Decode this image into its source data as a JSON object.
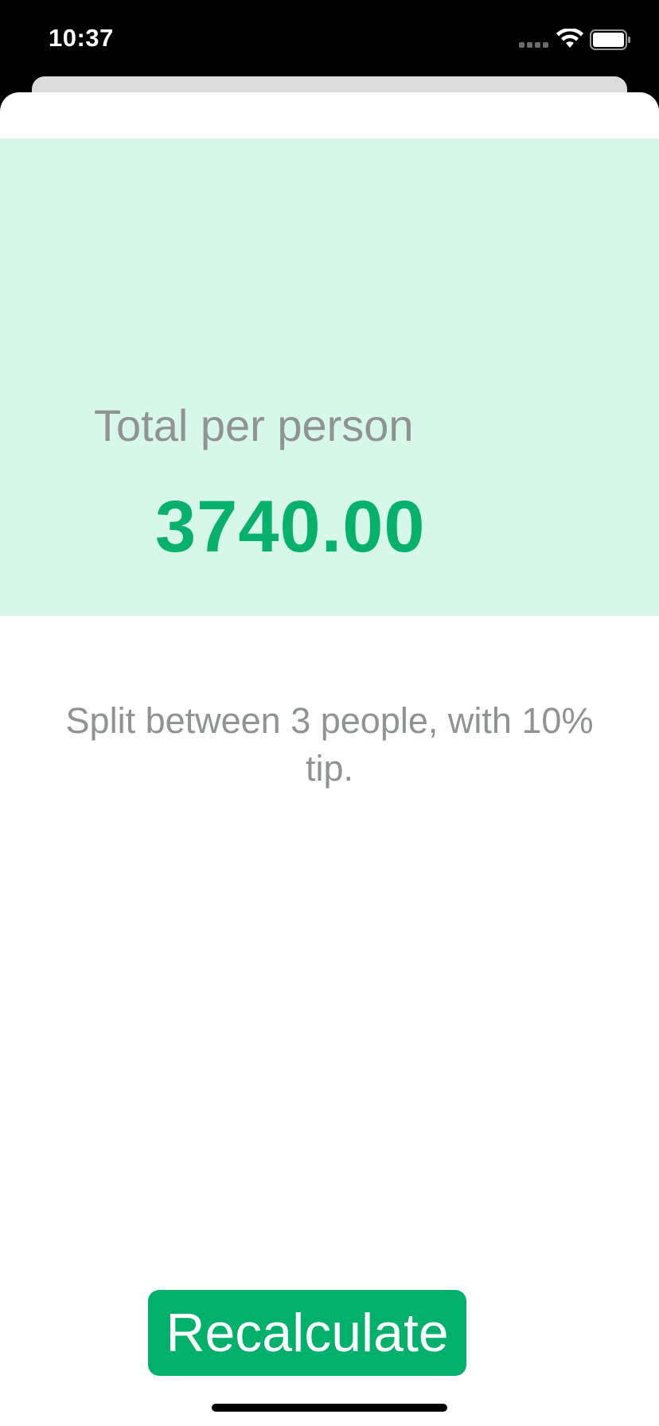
{
  "status_bar": {
    "time": "10:37",
    "signal_icon": "cellular-signal-icon",
    "wifi_icon": "wifi-icon",
    "battery_icon": "battery-full-icon"
  },
  "result": {
    "label": "Total per person",
    "value": "3740.00"
  },
  "settings": {
    "text": "Split between 3 people, with 10% tip."
  },
  "actions": {
    "recalculate_label": "Recalculate"
  },
  "colors": {
    "accent_green": "#00B06B",
    "result_text_green": "#06B16B",
    "result_panel_bg": "#D7F7EA",
    "secondary_text": "#8F9492"
  }
}
